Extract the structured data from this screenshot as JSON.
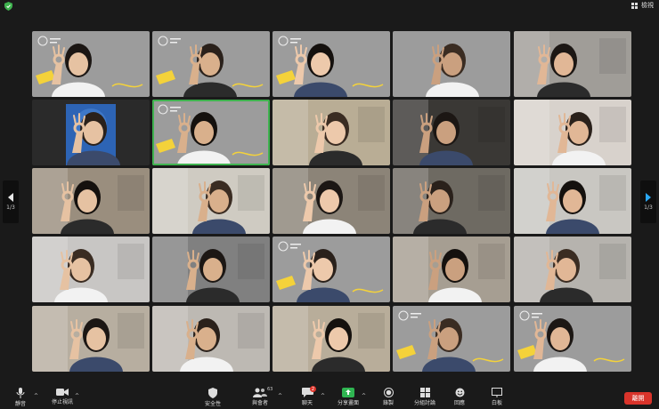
{
  "window": {
    "view_label": "檢視"
  },
  "pager": {
    "left_page": "1/3",
    "right_page": "1/3"
  },
  "toolbar": {
    "mute": "靜音",
    "stop_video": "停止視訊",
    "security": "安全性",
    "participants": "與會者",
    "participants_count": "63",
    "chat": "聊天",
    "chat_badge": "2",
    "share_screen": "分享畫面",
    "record": "錄製",
    "breakout": "分組討論",
    "reactions": "回應",
    "whiteboard": "白板",
    "leave": "離開"
  },
  "colors": {
    "active_speaker": "#3fb34f",
    "share_green": "#2fb551",
    "leave_red": "#d9342b",
    "tile_gray": "#9a9a9a"
  },
  "tiles": [
    {
      "bg": "#9c9c9c",
      "kind": "branded"
    },
    {
      "bg": "#9c9c9c",
      "kind": "branded"
    },
    {
      "bg": "#9c9c9c",
      "kind": "branded"
    },
    {
      "bg": "#9c9c9c",
      "kind": "plain"
    },
    {
      "bg": "#a09d98",
      "kind": "room"
    },
    {
      "bg": "#2a2a2a",
      "kind": "poster"
    },
    {
      "bg": "#9c9c9c",
      "kind": "branded-active"
    },
    {
      "bg": "#b9ad95",
      "kind": "room"
    },
    {
      "bg": "#3a3835",
      "kind": "room"
    },
    {
      "bg": "#d8d2cc",
      "kind": "room"
    },
    {
      "bg": "#9a8e7e",
      "kind": "room"
    },
    {
      "bg": "#cfcbc2",
      "kind": "room"
    },
    {
      "bg": "#8c8478",
      "kind": "room"
    },
    {
      "bg": "#6e6a62",
      "kind": "room"
    },
    {
      "bg": "#c9c7c2",
      "kind": "room"
    },
    {
      "bg": "#c8c6c4",
      "kind": "room"
    },
    {
      "bg": "#808080",
      "kind": "room"
    },
    {
      "bg": "#9c9c9c",
      "kind": "branded"
    },
    {
      "bg": "#a69e92",
      "kind": "room"
    },
    {
      "bg": "#b6b3ae",
      "kind": "room"
    },
    {
      "bg": "#b7aea0",
      "kind": "room"
    },
    {
      "bg": "#bdb9b3",
      "kind": "room"
    },
    {
      "bg": "#b8ad9a",
      "kind": "room"
    },
    {
      "bg": "#9c9c9c",
      "kind": "branded"
    },
    {
      "bg": "#9c9c9c",
      "kind": "branded"
    }
  ]
}
